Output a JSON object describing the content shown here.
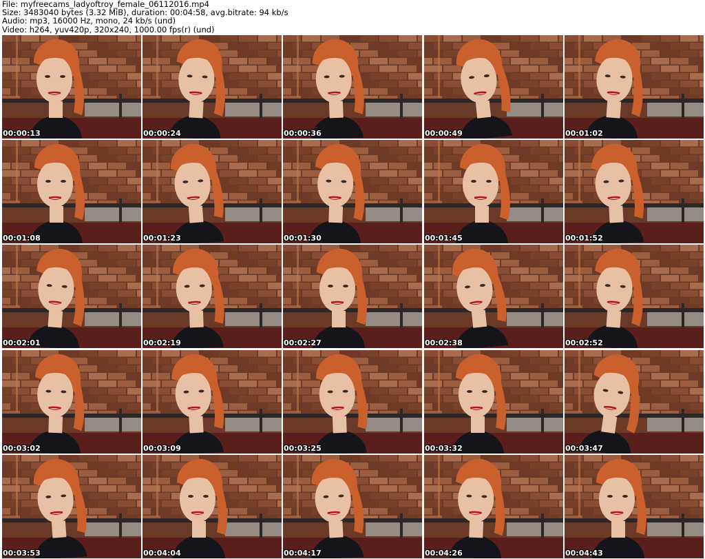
{
  "header": {
    "file_line": "File: myfreecams_ladyoftroy_female_06112016.mp4",
    "size_line": "Size: 3483040 bytes (3.32 MiB), duration: 00:04:58, avg.bitrate: 94 kb/s",
    "audio_line": "Audio: mp3, 16000 Hz, mono, 24 kb/s (und)",
    "video_line": "Video: h264, yuv420p, 320x240, 1000.00 fps(r) (und)"
  },
  "thumbnails": [
    {
      "timestamp": "00:00:13"
    },
    {
      "timestamp": "00:00:24"
    },
    {
      "timestamp": "00:00:36"
    },
    {
      "timestamp": "00:00:49"
    },
    {
      "timestamp": "00:01:02"
    },
    {
      "timestamp": "00:01:08"
    },
    {
      "timestamp": "00:01:23"
    },
    {
      "timestamp": "00:01:30"
    },
    {
      "timestamp": "00:01:45"
    },
    {
      "timestamp": "00:01:52"
    },
    {
      "timestamp": "00:02:01"
    },
    {
      "timestamp": "00:02:19"
    },
    {
      "timestamp": "00:02:27"
    },
    {
      "timestamp": "00:02:38"
    },
    {
      "timestamp": "00:02:52"
    },
    {
      "timestamp": "00:03:02"
    },
    {
      "timestamp": "00:03:09"
    },
    {
      "timestamp": "00:03:25"
    },
    {
      "timestamp": "00:03:32"
    },
    {
      "timestamp": "00:03:47"
    },
    {
      "timestamp": "00:03:53"
    },
    {
      "timestamp": "00:04:04"
    },
    {
      "timestamp": "00:04:17"
    },
    {
      "timestamp": "00:04:26"
    },
    {
      "timestamp": "00:04:43"
    }
  ],
  "colors": {
    "background": "#ffffff",
    "header_text": "#000000",
    "timestamp_text": "#ffffff",
    "brick_dark": "#6b3a26",
    "brick_light": "#a4684a",
    "hair": "#c9602e",
    "skin": "#e8c1a5",
    "shirt": "#15141a",
    "lips": "#b3151c",
    "shelf": "#2a2726"
  }
}
